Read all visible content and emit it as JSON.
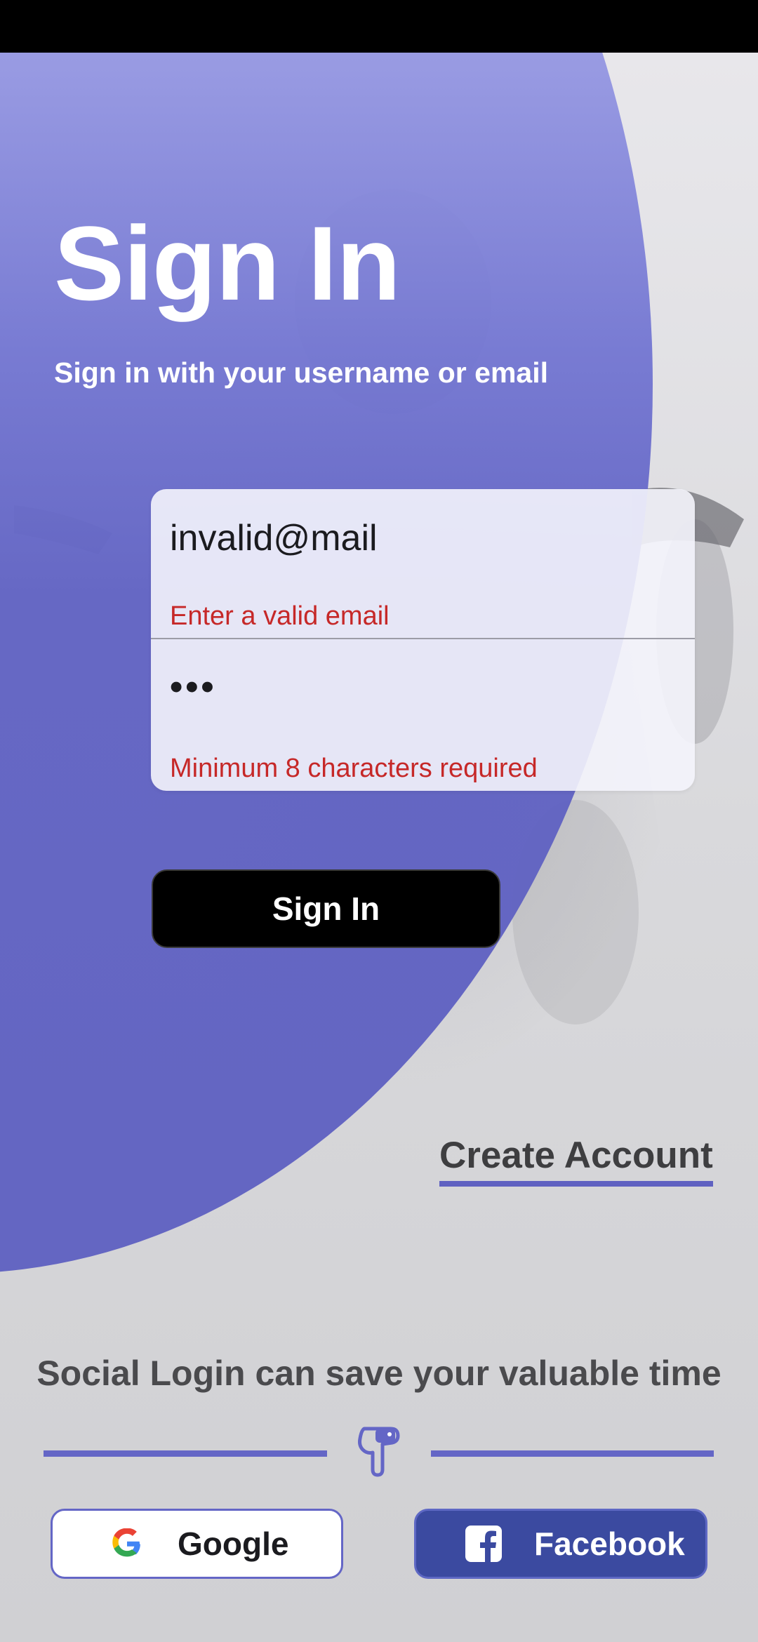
{
  "header": {
    "title": "Sign In",
    "subtitle": "Sign in with your username or email"
  },
  "form": {
    "email": {
      "value": "invalid@mail",
      "error": "Enter a valid email"
    },
    "password": {
      "value": "•••",
      "error": "Minimum 8 characters required"
    },
    "submit_label": "Sign In"
  },
  "create_account_label": "Create Account",
  "social": {
    "prompt": "Social Login can save your valuable time",
    "divider_icon": "pointing-hand-down-icon",
    "google_label": "Google",
    "facebook_label": "Facebook"
  },
  "colors": {
    "accent": "#5f61c1",
    "error": "#c62828",
    "facebook": "#3b4aa0",
    "button_dark": "#000000"
  }
}
